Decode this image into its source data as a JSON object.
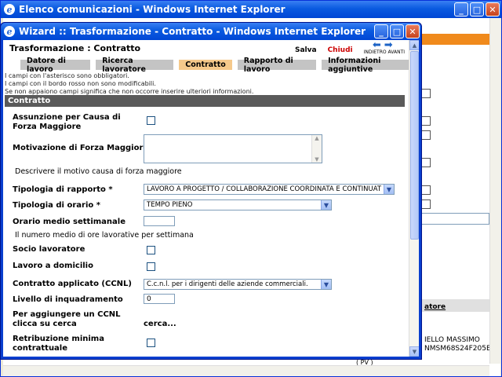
{
  "main_window": {
    "title": "Elenco comunicazioni - Windows Internet Explorer",
    "buttons": {
      "minimize": "_",
      "maximize": "□",
      "close": "✕"
    }
  },
  "background": {
    "link_fragment": "atore",
    "name_fragment": "IELLO MASSIMO",
    "code_fragment": "NMSM68S24F205E",
    "small_fragment": "( PV )"
  },
  "wizard": {
    "title": "Wizard :: Trasformazione - Contratto - Windows Internet Explorer",
    "header": "Trasformazione : Contratto",
    "actions": {
      "save": "Salva",
      "close": "Chiudi",
      "back": "INDIETRO",
      "forward": "AVANTI"
    },
    "tabs": [
      {
        "label": "Datore di lavoro",
        "active": false
      },
      {
        "label": "Ricerca lavoratore",
        "active": false
      },
      {
        "label": "Contratto",
        "active": true
      },
      {
        "label": "Rapporto di lavoro",
        "active": false
      },
      {
        "label": "Informazioni aggiuntive",
        "active": false
      }
    ],
    "notes": [
      "I campi con l'asterisco sono obbligatori.",
      "I campi con il bordo rosso non sono modificabili.",
      "Se non appaiono campi significa che non occorre inserire ulteriori informazioni."
    ],
    "section_title": "Contratto",
    "form": {
      "forza_maggiore_label": "Assunzione per Causa di Forza Maggiore",
      "motivazione_label": "Motivazione di Forza Maggiore",
      "motivazione_value": "",
      "motivazione_hint": "Descrivere il motivo causa di forza maggiore",
      "tipologia_rapporto_label": "Tipologia di rapporto *",
      "tipologia_rapporto_value": "LAVORO A PROGETTO / COLLABORAZIONE COORDINATA E CONTINUAT",
      "tipologia_orario_label": "Tipologia di orario *",
      "tipologia_orario_value": "TEMPO PIENO",
      "orario_label": "Orario medio settimanale",
      "orario_value": "",
      "orario_hint": "Il numero medio di ore lavorative per settimana",
      "socio_label": "Socio lavoratore",
      "domicilio_label": "Lavoro a domicilio",
      "ccnl_label": "Contratto applicato (CCNL)",
      "ccnl_value": "C.c.n.l. per i dirigenti delle aziende commerciali.",
      "livello_label": "Livello di inquadramento",
      "livello_value": "0",
      "aggiungere_label": "Per aggiungere un CCNL clicca su cerca",
      "cerca_link": "cerca...",
      "retribuzione_label": "Retribuzione minima contrattuale"
    }
  }
}
